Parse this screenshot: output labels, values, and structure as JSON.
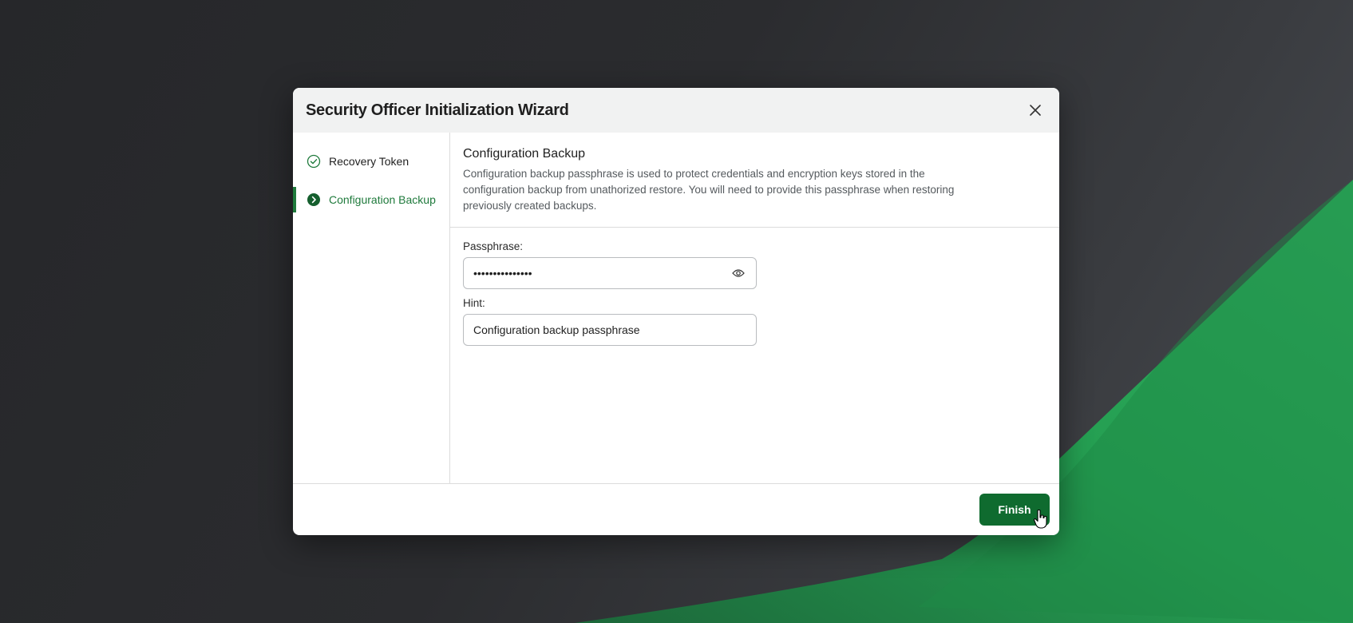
{
  "dialog": {
    "title": "Security Officer Initialization Wizard",
    "close_icon": "close-icon"
  },
  "steps": [
    {
      "label": "Recovery Token",
      "state": "completed",
      "icon": "check-circle-icon"
    },
    {
      "label": "Configuration Backup",
      "state": "active",
      "icon": "chevron-right-circle-icon"
    }
  ],
  "section": {
    "title": "Configuration Backup",
    "description": "Configuration backup passphrase is used to protect credentials and encryption keys stored in the configuration backup from unathorized restore. You will need to provide this passphrase when restoring previously created backups."
  },
  "form": {
    "passphrase_label": "Passphrase:",
    "passphrase_value": "•••••••••••••••",
    "passphrase_icon": "eye-icon",
    "hint_label": "Hint:",
    "hint_value": "Configuration backup passphrase"
  },
  "footer": {
    "finish_label": "Finish"
  },
  "colors": {
    "accent": "#1f7a3c",
    "button": "#0f6b2f"
  }
}
